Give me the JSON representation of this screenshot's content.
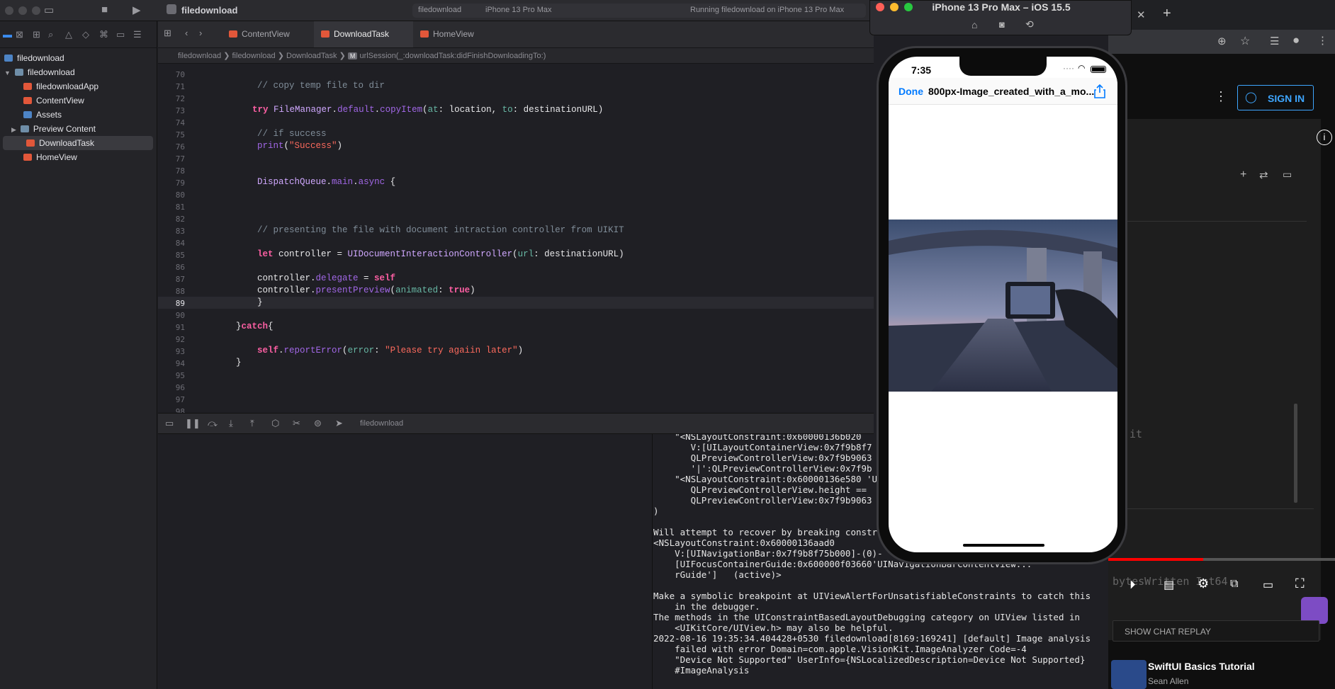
{
  "toolbar": {
    "project_name": "filedownload",
    "scheme": "filedownload",
    "destination": "iPhone 13 Pro Max",
    "status": "Running filedownload on iPhone 13 Pro Max"
  },
  "navigator": {
    "items": [
      {
        "label": "filedownload",
        "kind": "project"
      },
      {
        "label": "filedownload",
        "kind": "folder"
      },
      {
        "label": "filedownloadApp",
        "kind": "swift"
      },
      {
        "label": "ContentView",
        "kind": "swift"
      },
      {
        "label": "Assets",
        "kind": "assets"
      },
      {
        "label": "Preview Content",
        "kind": "folder"
      },
      {
        "label": "DownloadTask",
        "kind": "swift",
        "selected": true
      },
      {
        "label": "HomeView",
        "kind": "swift"
      }
    ]
  },
  "editor": {
    "tabs": [
      {
        "label": "ContentView"
      },
      {
        "label": "DownloadTask",
        "selected": true
      },
      {
        "label": "HomeView"
      }
    ],
    "breadcrumb": [
      "filedownload",
      "filedownload",
      "DownloadTask",
      "urlSession(_:downloadTask:didFinishDownloadingTo:)"
    ],
    "line_numbers": [
      "70",
      "71",
      "72",
      "73",
      "74",
      "75",
      "76",
      "77",
      "78",
      "79",
      "80",
      "81",
      "82",
      "83",
      "84",
      "85",
      "86",
      "87",
      "88",
      "89",
      "90",
      "91",
      "92",
      "93",
      "94",
      "95",
      "96",
      "97",
      "98"
    ],
    "current_line": "89"
  },
  "debug": {
    "process": "filedownload",
    "console_lines": [
      "    \"<NSLayoutConstraint:0x60000136b020",
      "       V:[UILayoutContainerView:0x7f9b8f7",
      "       QLPreviewControllerView:0x7f9b9063",
      "       '|':QLPreviewControllerView:0x7f9b",
      "    \"<NSLayoutConstraint:0x60000136e580 'U",
      "       QLPreviewControllerView.height ==",
      "       QLPreviewControllerView:0x7f9b9063",
      ")",
      "",
      "Will attempt to recover by breaking constr",
      "<NSLayoutConstraint:0x60000136aad0",
      "    V:[UINavigationBar:0x7f9b8f75b000]-(0)-",
      "    [UIFocusContainerGuide:0x600000f03660'UINavigationBarContentView...",
      "    rGuide']   (active)>",
      "",
      "Make a symbolic breakpoint at UIViewAlertForUnsatisfiableConstraints to catch this",
      "    in the debugger.",
      "The methods in the UIConstraintBasedLayoutDebugging category on UIView listed in",
      "    <UIKitCore/UIView.h> may also be helpful.",
      "2022-08-16 19:35:34.404428+0530 filedownload[8169:169241] [default] Image analysis",
      "    failed with error Domain=com.apple.VisionKit.ImageAnalyzer Code=-4",
      "    \"Device Not Supported\" UserInfo={NSLocalizedDescription=Device Not Supported}",
      "    #ImageAnalysis"
    ]
  },
  "simulator": {
    "title": "iPhone 13 Pro Max – iOS 15.5",
    "time": "7:35",
    "done_label": "Done",
    "nav_title": "800px-Image_created_with_a_mo..."
  },
  "browser": {
    "sign_in": "SIGN IN",
    "video_caption": "bytesWritten Int64",
    "chat_replay": "SHOW CHAT REPLAY",
    "related_title": "SwiftUI Basics Tutorial",
    "related_channel": "Sean Allen",
    "code_fragment": "it"
  }
}
